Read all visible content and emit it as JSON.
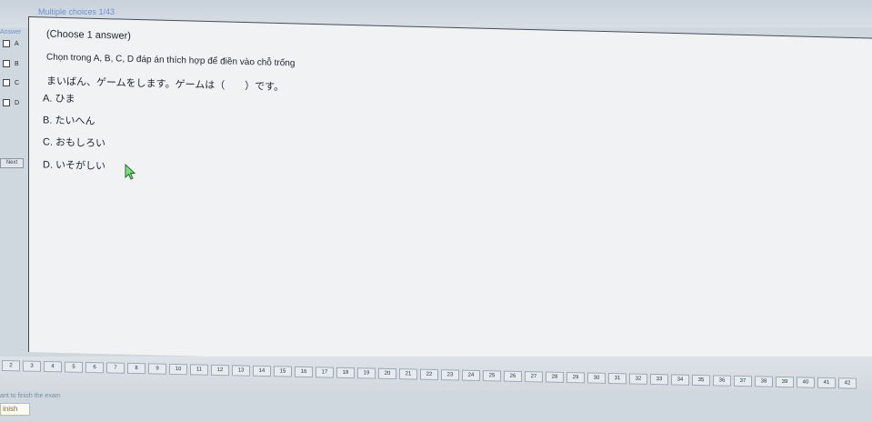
{
  "header": {
    "title": "Multiple choices 1/43"
  },
  "sidebar": {
    "answer_label": "Answer",
    "options": [
      "A",
      "B",
      "C",
      "D"
    ],
    "next_label": "Next"
  },
  "question": {
    "head": "(Choose 1 answer)",
    "instruction": "Chọn trong A, B, C, D đáp án thích hợp để điền vào chỗ trống",
    "text": "まいばん、ゲームをします。ゲームは（　　）です。",
    "choices": [
      "A. ひま",
      "B. たいへん",
      "C. おもしろい",
      "D. いそがしい"
    ]
  },
  "pager": {
    "pages": [
      "2",
      "3",
      "4",
      "5",
      "6",
      "7",
      "8",
      "9",
      "10",
      "11",
      "12",
      "13",
      "14",
      "15",
      "16",
      "17",
      "18",
      "19",
      "20",
      "21",
      "22",
      "23",
      "24",
      "25",
      "26",
      "27",
      "28",
      "29",
      "30",
      "31",
      "32",
      "33",
      "34",
      "35",
      "36",
      "37",
      "38",
      "39",
      "40",
      "41",
      "42"
    ]
  },
  "footer": {
    "note": "ant to finish the exam",
    "finish_label": "inish"
  }
}
